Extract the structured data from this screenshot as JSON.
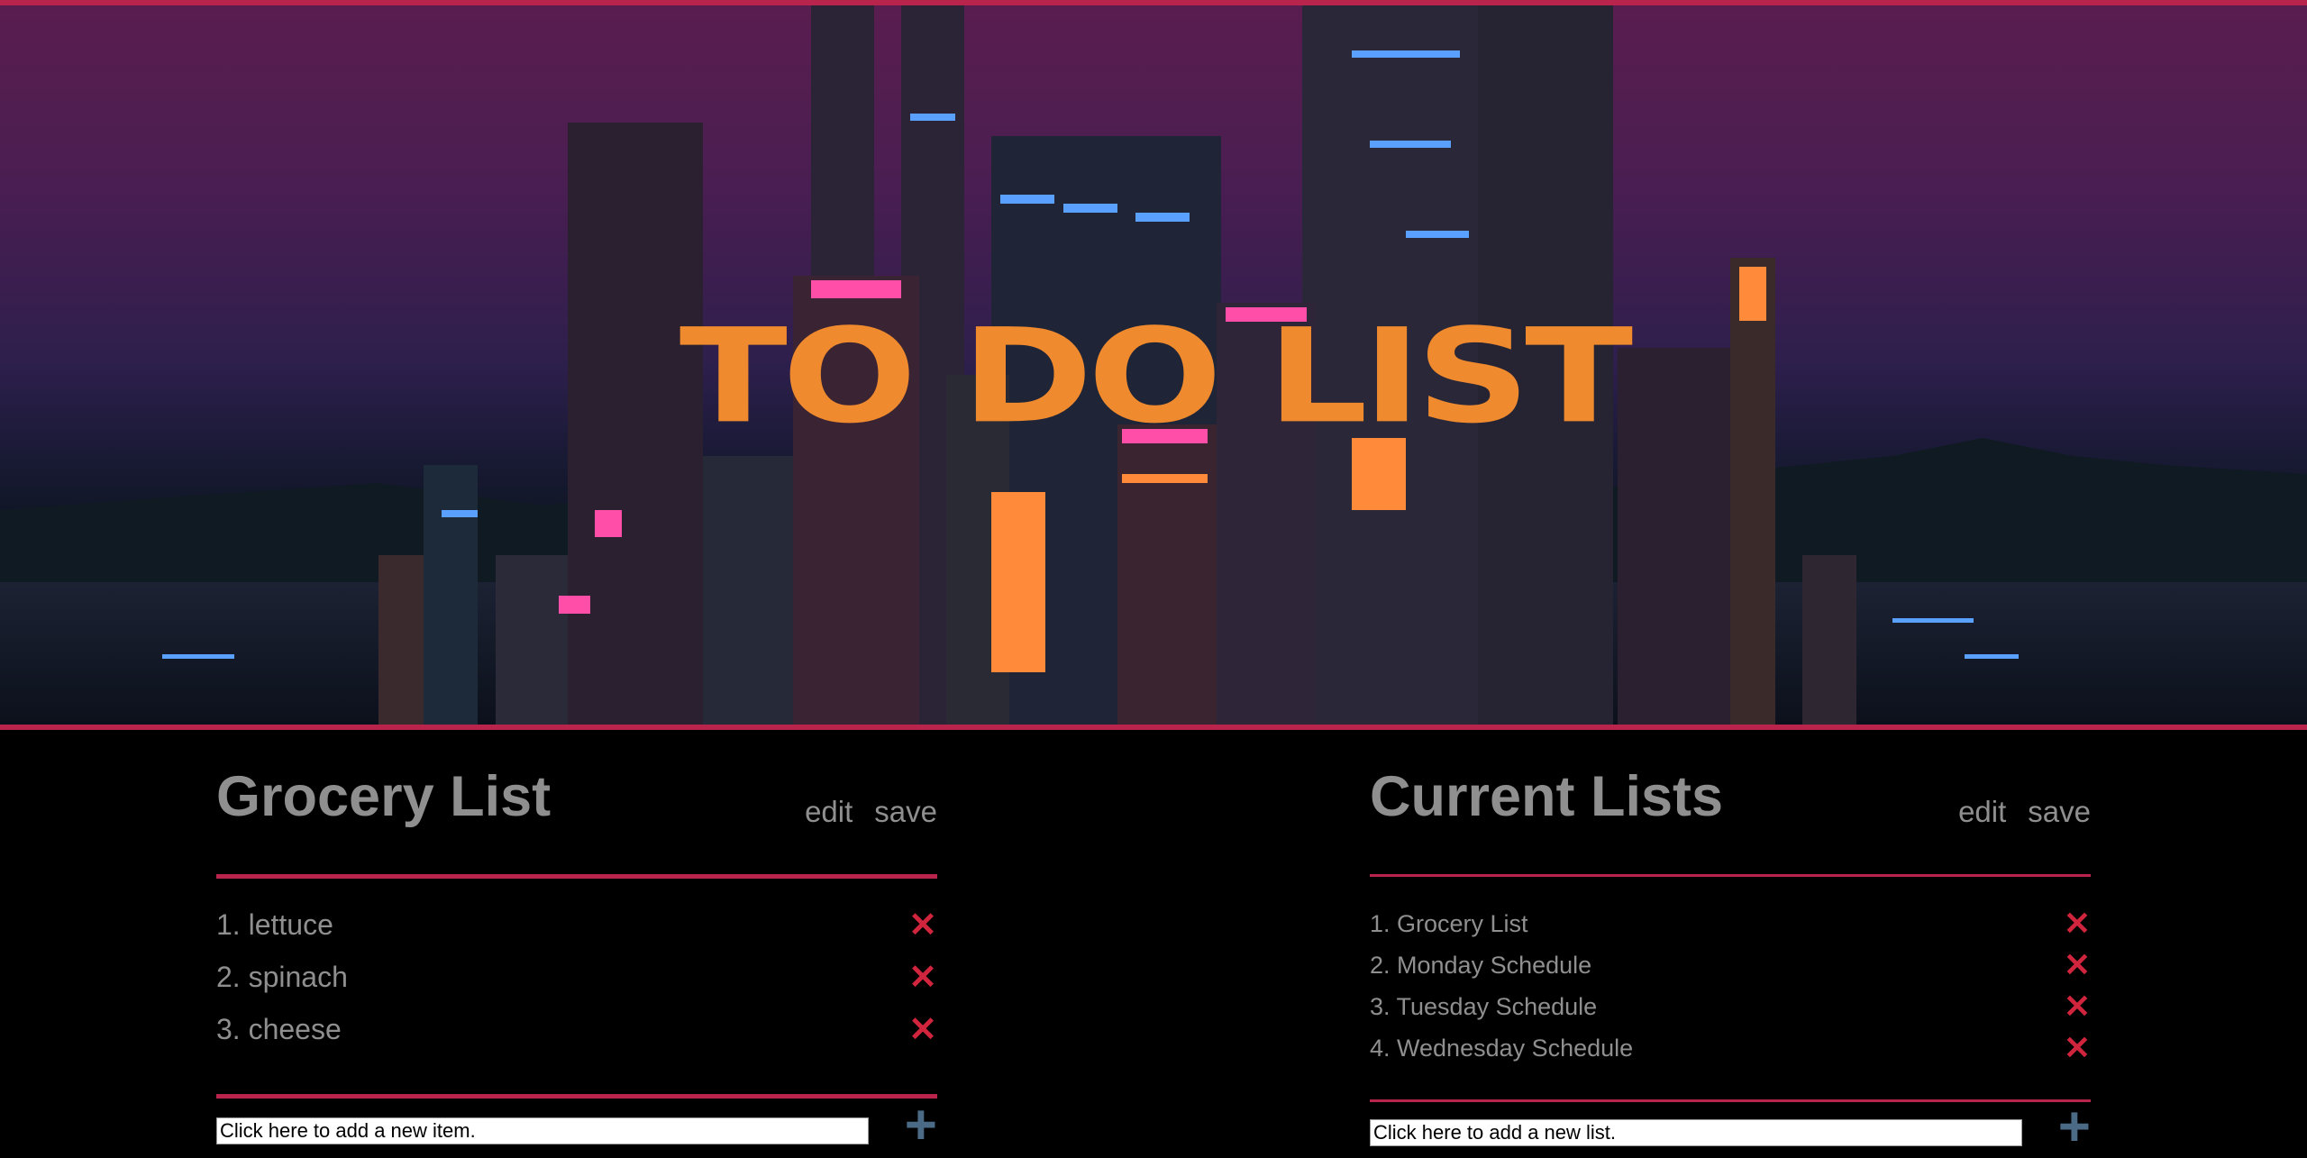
{
  "hero": {
    "title": "TO DO LIST"
  },
  "grocery_panel": {
    "title": "Grocery List",
    "edit_label": "edit",
    "save_label": "save",
    "items": [
      {
        "label": "1. lettuce"
      },
      {
        "label": "2. spinach"
      },
      {
        "label": "3. cheese"
      }
    ],
    "delete_glyph": "✕",
    "add_placeholder": "Click here to add a new item.",
    "add_glyph": "+"
  },
  "lists_panel": {
    "title": "Current Lists",
    "edit_label": "edit",
    "save_label": "save",
    "items": [
      {
        "label": "1. Grocery List"
      },
      {
        "label": "2. Monday Schedule"
      },
      {
        "label": "3. Tuesday Schedule"
      },
      {
        "label": "4. Wednesday Schedule"
      }
    ],
    "delete_glyph": "✕",
    "add_placeholder": "Click here to add a new list.",
    "add_glyph": "+"
  },
  "colors": {
    "accent_rule": "#b8244c",
    "title_orange": "#f08a2e",
    "delete_red": "#d1243d",
    "add_blue": "#4a6a86",
    "text_grey": "#8f8f8f"
  },
  "icons": {
    "delete": "close-icon",
    "add": "plus-icon"
  }
}
